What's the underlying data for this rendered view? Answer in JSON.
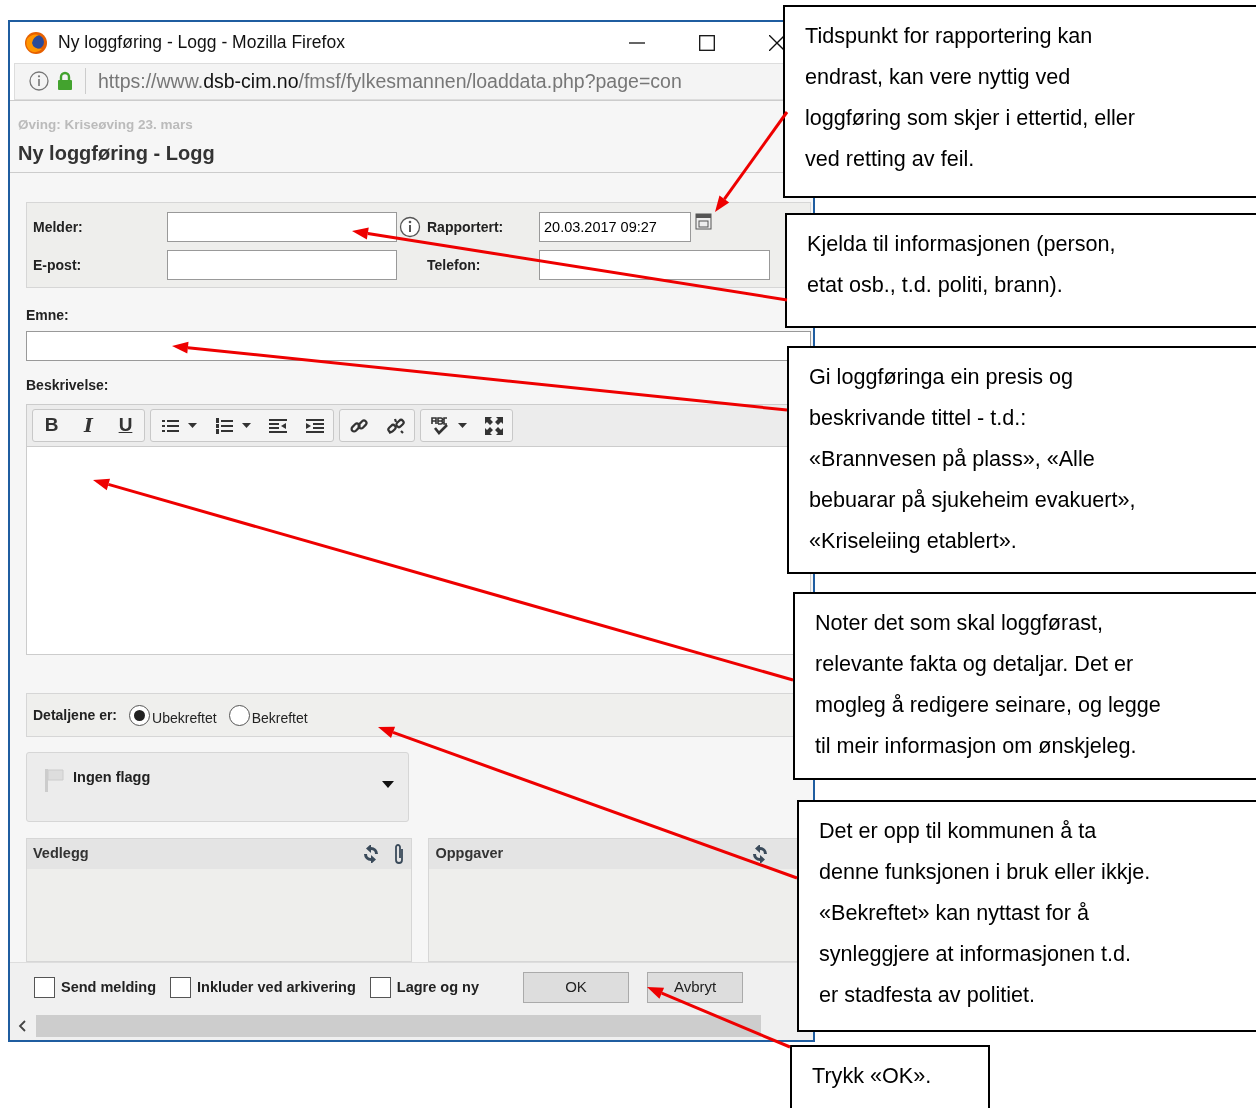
{
  "browser": {
    "title": "Ny loggføring - Logg - Mozilla Firefox",
    "url": {
      "prefix": "https://www.",
      "domain": "dsb-cim.no",
      "path": "/fmsf/fylkesmannen/loaddata.php?page=con"
    }
  },
  "page": {
    "breadcrumb": "Øving: Kriseøving 23. mars",
    "heading": "Ny loggføring - Logg"
  },
  "form": {
    "melder_label": "Melder:",
    "rapportert_label": "Rapportert:",
    "rapportert_value": "20.03.2017 09:27",
    "epost_label": "E-post:",
    "telefon_label": "Telefon:",
    "emne_label": "Emne:",
    "beskrivelse_label": "Beskrivelse:"
  },
  "toolbar": [
    [
      {
        "kind": "bold",
        "label": "B"
      },
      {
        "kind": "italic",
        "label": "I"
      },
      {
        "kind": "underline",
        "label": "U"
      }
    ],
    [
      {
        "kind": "bullets"
      },
      {
        "kind": "numbers"
      },
      {
        "kind": "outdent"
      },
      {
        "kind": "indent"
      }
    ],
    [
      {
        "kind": "link"
      },
      {
        "kind": "unlink"
      }
    ],
    [
      {
        "kind": "spell"
      },
      {
        "kind": "maximize"
      }
    ]
  ],
  "details": {
    "label": "Detaljene er:",
    "options": [
      {
        "label": "Ubekreftet",
        "selected": true
      },
      {
        "label": "Bekreftet",
        "selected": false
      }
    ]
  },
  "flag": {
    "label": "Ingen flagg"
  },
  "panels": [
    {
      "title": "Vedlegg",
      "kind": "attachments"
    },
    {
      "title": "Oppgaver",
      "kind": "tasks"
    }
  ],
  "footer_checkboxes": [
    {
      "label": "Send melding",
      "checked": false
    },
    {
      "label": "Inkluder ved arkivering",
      "checked": false
    },
    {
      "label": "Lagre og ny",
      "checked": false
    }
  ],
  "buttons": [
    "OK",
    "Avbryt"
  ],
  "callouts": [
    {
      "lines": [
        "Tidspunkt for rapportering kan",
        "endrast, kan vere nyttig ved",
        "loggføring som skjer i ettertid, eller",
        "ved retting av feil."
      ]
    },
    {
      "lines": [
        "Kjelda til informasjonen (person,",
        "etat osb., t.d. politi, brann)."
      ]
    },
    {
      "lines": [
        "Gi loggføringa ein presis og",
        "beskrivande tittel - t.d.:",
        "«Brannvesen på plass», «Alle",
        "bebuarar på sjukeheim evakuert»,",
        "«Kriseleiing etablert»."
      ]
    },
    {
      "lines": [
        "Noter det som skal loggførast,",
        "relevante fakta og detaljar. Det er",
        "mogleg å redigere seinare, og legge",
        "til meir informasjon om ønskjeleg."
      ]
    },
    {
      "lines": [
        "Det er opp til kommunen å ta",
        "denne funksjonen i bruk eller ikkje.",
        "«Bekreftet» kan nyttast for å",
        "synleggjere at informasjonen t.d.",
        "er stadfesta av politiet."
      ]
    },
    {
      "lines": [
        "Trykk «OK»."
      ]
    }
  ]
}
